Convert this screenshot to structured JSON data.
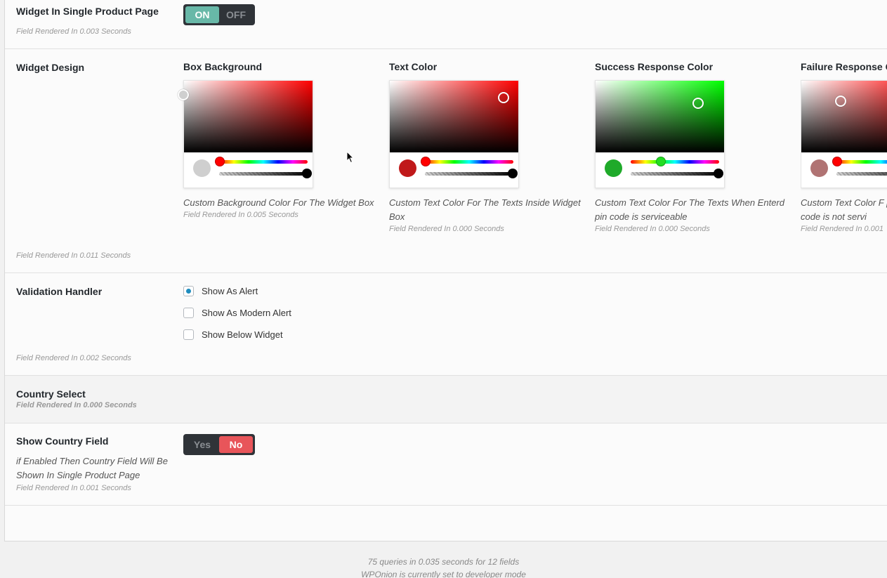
{
  "fields": {
    "single_product": {
      "label": "Widget In Single Product Page",
      "toggle_on": "ON",
      "toggle_off": "OFF",
      "state": "on",
      "render": "Field Rendered In 0.003 Seconds"
    },
    "widget_design": {
      "label": "Widget Design",
      "render": "Field Rendered In 0.011 Seconds",
      "colors": [
        {
          "title": "Box Background",
          "desc": "Custom Background Color For The Widget Box",
          "render": "Field Rendered In 0.005 Seconds",
          "hue_color": "#ff0000",
          "swatch": "#cfcfcf",
          "hue_knob_color": "#ff0000"
        },
        {
          "title": "Text Color",
          "desc": "Custom Text Color For The Texts Inside Widget Box",
          "render": "Field Rendered In 0.000 Seconds",
          "hue_color": "#ff0000",
          "swatch": "#c0191a",
          "hue_knob_color": "#ff0000"
        },
        {
          "title": "Success Response Color",
          "desc": "Custom Text Color For The Texts When Enterd pin code is serviceable",
          "render": "Field Rendered In 0.000 Seconds",
          "hue_color": "#00ff00",
          "swatch": "#1faa2a",
          "hue_knob_color": "#22dd22"
        },
        {
          "title": "Failure Response C",
          "desc": "Custom Text Color F pin code is not servi",
          "render": "Field Rendered In 0.001",
          "hue_color": "#ff0000",
          "swatch": "#b07373",
          "hue_knob_color": "#ff0000"
        }
      ]
    },
    "validation": {
      "label": "Validation Handler",
      "options": [
        {
          "label": "Show As Alert",
          "checked": true
        },
        {
          "label": "Show As Modern Alert",
          "checked": false
        },
        {
          "label": "Show Below Widget",
          "checked": false
        }
      ],
      "render": "Field Rendered In 0.002 Seconds"
    },
    "country_select": {
      "label": "Country Select",
      "render": "Field Rendered In 0.000 Seconds"
    },
    "show_country": {
      "label": "Show Country Field",
      "desc": "if Enabled Then Country Field Will Be Shown In Single Product Page",
      "toggle_yes": "Yes",
      "toggle_no": "No",
      "state": "no",
      "render": "Field Rendered In 0.001 Seconds"
    }
  },
  "footer": {
    "line1": "75 queries in 0.035 seconds for 12 fields",
    "line2": "WPOnion is currently set to developer mode"
  },
  "colors": {
    "toggle_on": "#68b8a8",
    "toggle_no": "#e8555a",
    "radio_checked": "#1e8cbe"
  }
}
